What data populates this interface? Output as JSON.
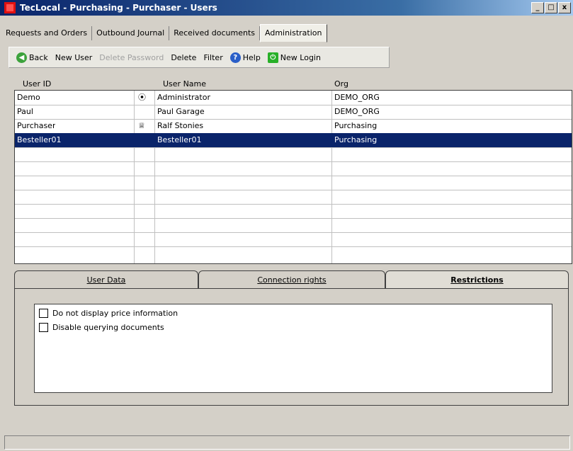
{
  "window": {
    "title": "TecLocal - Purchasing - Purchaser - Users",
    "min_label": "_",
    "max_label": "□",
    "close_label": "x"
  },
  "main_tabs": [
    {
      "label": "Requests and Orders"
    },
    {
      "label": "Outbound Journal"
    },
    {
      "label": "Received documents"
    },
    {
      "label": "Administration",
      "active": true
    }
  ],
  "toolbar": {
    "back": "Back",
    "new_user": "New User",
    "delete_password": "Delete Password",
    "delete": "Delete",
    "filter": "Filter",
    "help": "Help",
    "new_login": "New Login"
  },
  "grid": {
    "columns": [
      "User ID",
      "User Name",
      "Org"
    ],
    "rows": [
      {
        "user_id": "Demo",
        "icon": "admin-icon",
        "icon_glyph": "⦿",
        "user_name": "Administrator",
        "org": "DEMO_ORG"
      },
      {
        "user_id": "Paul",
        "icon": "",
        "icon_glyph": "",
        "user_name": "Paul Garage",
        "org": "DEMO_ORG"
      },
      {
        "user_id": "Purchaser",
        "icon": "crown-icon",
        "icon_glyph": "♕",
        "user_name": "Ralf Stonies",
        "org": "Purchasing"
      },
      {
        "user_id": "Besteller01",
        "icon": "",
        "icon_glyph": "",
        "user_name": "Besteller01",
        "org": "Purchasing",
        "selected": true
      }
    ],
    "selected_color": "#0a246a"
  },
  "sub_tabs": [
    {
      "label": "User Data"
    },
    {
      "label": "Connection rights"
    },
    {
      "label": "Restrictions",
      "active": true
    }
  ],
  "restrictions": [
    {
      "label": "Do not display price information",
      "checked": false
    },
    {
      "label": "Disable querying documents",
      "checked": false
    }
  ]
}
